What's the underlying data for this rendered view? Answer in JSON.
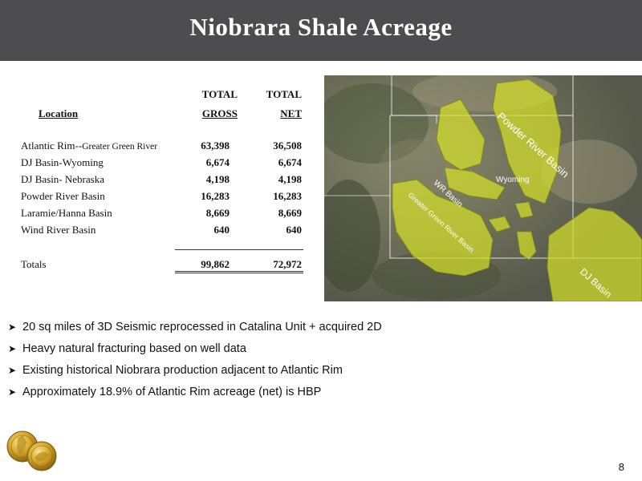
{
  "title": "Niobrara Shale Acreage",
  "table": {
    "headers": {
      "total_gross": "TOTAL",
      "gross": "GROSS",
      "total_net": "TOTAL",
      "net": "NET",
      "location": "Location"
    },
    "rows": [
      {
        "location": "Atlantic Rim--",
        "location_small": "Greater Green River",
        "gross": "63,398",
        "net": "36,508"
      },
      {
        "location": "DJ Basin-Wyoming",
        "location_small": "",
        "gross": "6,674",
        "net": "6,674"
      },
      {
        "location": "DJ Basin- Nebraska",
        "location_small": "",
        "gross": "4,198",
        "net": "4,198"
      },
      {
        "location": "Powder River Basin",
        "location_small": "",
        "gross": "16,283",
        "net": "16,283"
      },
      {
        "location": "Laramie/Hanna Basin",
        "location_small": "",
        "gross": "8,669",
        "net": "8,669"
      },
      {
        "location": "Wind River Basin",
        "location_small": "",
        "gross": "640",
        "net": "640"
      }
    ],
    "totals": {
      "label": "Totals",
      "gross": "99,862",
      "net": "72,972"
    }
  },
  "map": {
    "labels": {
      "powder_river": "Powder River Basin",
      "wyoming": "Wyoming",
      "wr_basin": "WR Basin",
      "greater_green_river": "Greater Green River Basin",
      "dj_basin": "DJ Basin"
    },
    "colors": {
      "acreage": "#d4df2a",
      "border": "#ffffff"
    }
  },
  "bullets": [
    "20 sq miles of 3D Seismic reprocessed in Catalina Unit + acquired 2D",
    "Heavy natural fracturing based on well data",
    "Existing historical Niobrara production adjacent to Atlantic Rim",
    "Approximately 18.9% of Atlantic Rim acreage (net) is HBP"
  ],
  "bullet_icon": "arrow-bullet-icon",
  "page_number": "8",
  "colors": {
    "title_bar": "#4d4d4f",
    "title_text": "#ffffff"
  }
}
